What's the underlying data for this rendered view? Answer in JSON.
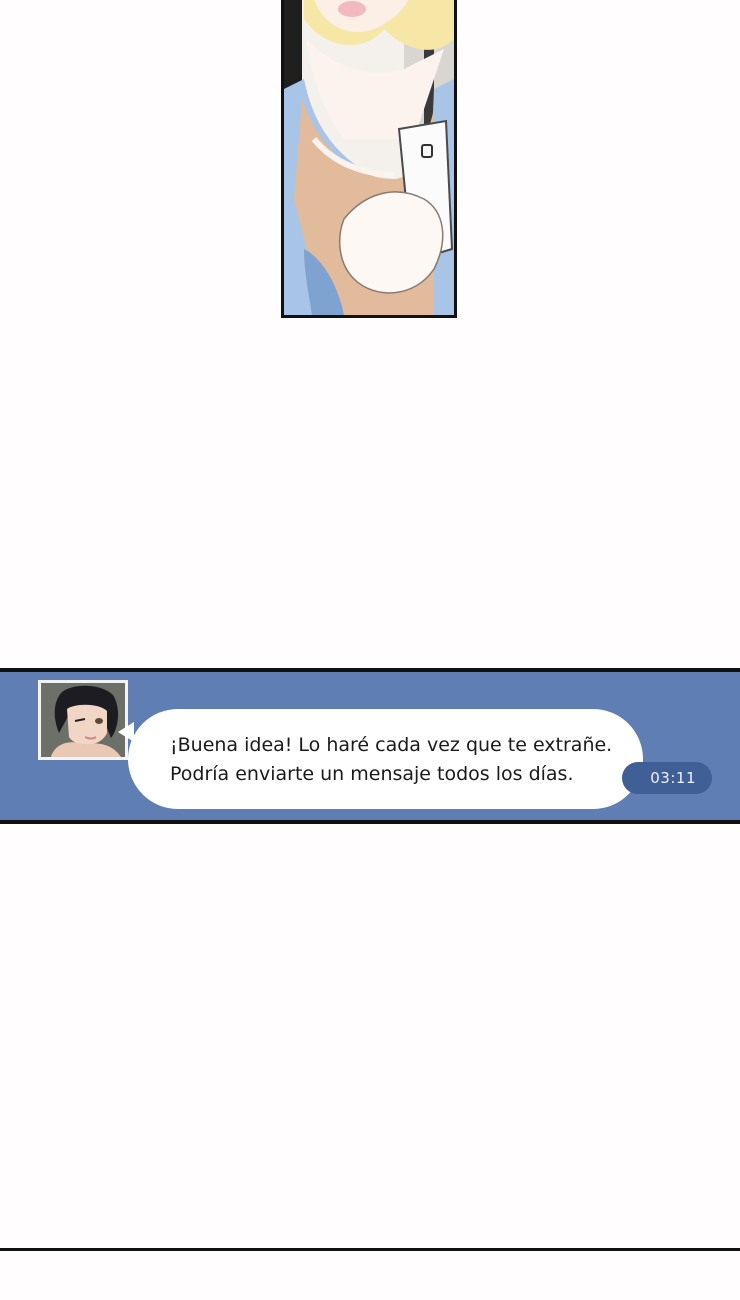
{
  "comic_panel": {
    "description_icon": "person-holding-phone-illustration"
  },
  "chat": {
    "avatar_icon": "winking-man-avatar-icon",
    "message_lines": [
      "¡Buena idea! Lo haré cada vez que te extrañe.",
      "Podría enviarte un mensaje todos los días."
    ],
    "timestamp": "03:11"
  },
  "colors": {
    "chat_background": "#5f7fb4",
    "timestamp_pill": "#3f5f96",
    "bubble": "#ffffff",
    "frame_border": "#111111"
  }
}
